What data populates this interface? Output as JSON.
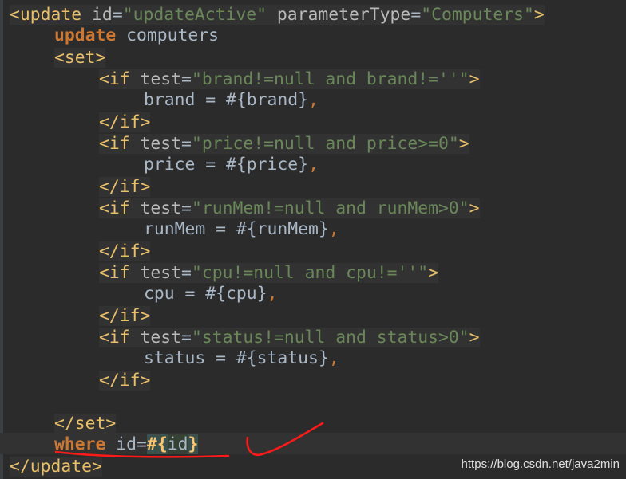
{
  "editor": {
    "background": "#2b2b2b",
    "lines": [
      {
        "id": "l1",
        "segments": [
          "<update",
          " ",
          "id",
          "=",
          "\"updateActive\"",
          " ",
          "parameterType",
          "=",
          "\"Computers\"",
          ">"
        ]
      },
      {
        "id": "l2",
        "segments": [
          "update",
          " computers"
        ]
      },
      {
        "id": "l3",
        "segments": [
          "<set>"
        ]
      },
      {
        "id": "l4",
        "segments": [
          "<if",
          " ",
          "test",
          "=",
          "\"brand!=null and brand!=''\"",
          ">"
        ]
      },
      {
        "id": "l5",
        "segments": [
          "brand = #{brand}",
          ","
        ]
      },
      {
        "id": "l6",
        "segments": [
          "</if>"
        ]
      },
      {
        "id": "l7",
        "segments": [
          "<if",
          " ",
          "test",
          "=",
          "\"price!=null and price>=0\"",
          ">"
        ]
      },
      {
        "id": "l8",
        "segments": [
          "price = #{price}",
          ","
        ]
      },
      {
        "id": "l9",
        "segments": [
          "</if>"
        ]
      },
      {
        "id": "l10",
        "segments": [
          "<if",
          " ",
          "test",
          "=",
          "\"runMem!=null and runMem>0\"",
          ">"
        ]
      },
      {
        "id": "l11",
        "segments": [
          "runMem = #{runMem}",
          ","
        ]
      },
      {
        "id": "l12",
        "segments": [
          "</if>"
        ]
      },
      {
        "id": "l13",
        "segments": [
          "<if",
          " ",
          "test",
          "=",
          "\"cpu!=null and cpu!=''\"",
          ">"
        ]
      },
      {
        "id": "l14",
        "segments": [
          "cpu = #{cpu}",
          ","
        ]
      },
      {
        "id": "l15",
        "segments": [
          "</if>"
        ]
      },
      {
        "id": "l16",
        "segments": [
          "<if",
          " ",
          "test",
          "=",
          "\"status!=null and status>0\"",
          ">"
        ]
      },
      {
        "id": "l17",
        "segments": [
          "status = #{status}",
          ","
        ]
      },
      {
        "id": "l18",
        "segments": [
          "</if>"
        ]
      },
      {
        "id": "l19",
        "segments": [
          ""
        ]
      },
      {
        "id": "l20",
        "segments": [
          "</set>"
        ]
      },
      {
        "id": "l21",
        "segments": [
          "where",
          " id=",
          "#",
          "{",
          "id",
          "}"
        ]
      },
      {
        "id": "l22",
        "segments": [
          "</update>"
        ]
      }
    ]
  },
  "watermark": "https://blog.csdn.net/java2min",
  "colors": {
    "tag": "#e8bf6a",
    "attribute": "#bababa",
    "string": "#6a8759",
    "keyword": "#cc7832",
    "text": "#a9b7c6",
    "annotation": "#ff1a1a"
  }
}
